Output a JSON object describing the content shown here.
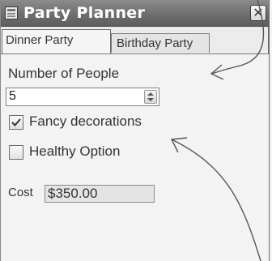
{
  "window": {
    "title": "Party Planner",
    "icon": "app-window-icon",
    "close_glyph": "✕"
  },
  "tabs": [
    {
      "label": "Dinner Party",
      "selected": true
    },
    {
      "label": "Birthday Party",
      "selected": false
    }
  ],
  "dinner_party": {
    "people_label": "Number of People",
    "people_value": "5",
    "fancy_label": "Fancy decorations",
    "fancy_checked": true,
    "healthy_label": "Healthy Option",
    "healthy_checked": false,
    "cost_label": "Cost",
    "cost_value": "$350.00"
  },
  "colors": {
    "titlebar": "#6e6e6e",
    "title_text": "#ffffff",
    "panel_bg": "#f3f3f3",
    "annotation_ink": "#555555"
  }
}
